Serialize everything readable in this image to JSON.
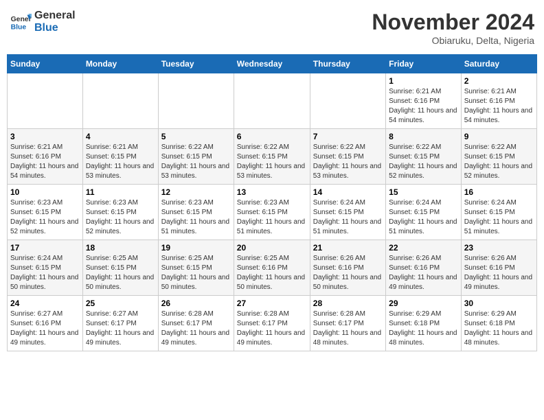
{
  "logo": {
    "line1": "General",
    "line2": "Blue"
  },
  "title": "November 2024",
  "location": "Obiaruku, Delta, Nigeria",
  "weekdays": [
    "Sunday",
    "Monday",
    "Tuesday",
    "Wednesday",
    "Thursday",
    "Friday",
    "Saturday"
  ],
  "weeks": [
    [
      {
        "day": "",
        "info": ""
      },
      {
        "day": "",
        "info": ""
      },
      {
        "day": "",
        "info": ""
      },
      {
        "day": "",
        "info": ""
      },
      {
        "day": "",
        "info": ""
      },
      {
        "day": "1",
        "info": "Sunrise: 6:21 AM\nSunset: 6:16 PM\nDaylight: 11 hours and 54 minutes."
      },
      {
        "day": "2",
        "info": "Sunrise: 6:21 AM\nSunset: 6:16 PM\nDaylight: 11 hours and 54 minutes."
      }
    ],
    [
      {
        "day": "3",
        "info": "Sunrise: 6:21 AM\nSunset: 6:16 PM\nDaylight: 11 hours and 54 minutes."
      },
      {
        "day": "4",
        "info": "Sunrise: 6:21 AM\nSunset: 6:15 PM\nDaylight: 11 hours and 53 minutes."
      },
      {
        "day": "5",
        "info": "Sunrise: 6:22 AM\nSunset: 6:15 PM\nDaylight: 11 hours and 53 minutes."
      },
      {
        "day": "6",
        "info": "Sunrise: 6:22 AM\nSunset: 6:15 PM\nDaylight: 11 hours and 53 minutes."
      },
      {
        "day": "7",
        "info": "Sunrise: 6:22 AM\nSunset: 6:15 PM\nDaylight: 11 hours and 53 minutes."
      },
      {
        "day": "8",
        "info": "Sunrise: 6:22 AM\nSunset: 6:15 PM\nDaylight: 11 hours and 52 minutes."
      },
      {
        "day": "9",
        "info": "Sunrise: 6:22 AM\nSunset: 6:15 PM\nDaylight: 11 hours and 52 minutes."
      }
    ],
    [
      {
        "day": "10",
        "info": "Sunrise: 6:23 AM\nSunset: 6:15 PM\nDaylight: 11 hours and 52 minutes."
      },
      {
        "day": "11",
        "info": "Sunrise: 6:23 AM\nSunset: 6:15 PM\nDaylight: 11 hours and 52 minutes."
      },
      {
        "day": "12",
        "info": "Sunrise: 6:23 AM\nSunset: 6:15 PM\nDaylight: 11 hours and 51 minutes."
      },
      {
        "day": "13",
        "info": "Sunrise: 6:23 AM\nSunset: 6:15 PM\nDaylight: 11 hours and 51 minutes."
      },
      {
        "day": "14",
        "info": "Sunrise: 6:24 AM\nSunset: 6:15 PM\nDaylight: 11 hours and 51 minutes."
      },
      {
        "day": "15",
        "info": "Sunrise: 6:24 AM\nSunset: 6:15 PM\nDaylight: 11 hours and 51 minutes."
      },
      {
        "day": "16",
        "info": "Sunrise: 6:24 AM\nSunset: 6:15 PM\nDaylight: 11 hours and 51 minutes."
      }
    ],
    [
      {
        "day": "17",
        "info": "Sunrise: 6:24 AM\nSunset: 6:15 PM\nDaylight: 11 hours and 50 minutes."
      },
      {
        "day": "18",
        "info": "Sunrise: 6:25 AM\nSunset: 6:15 PM\nDaylight: 11 hours and 50 minutes."
      },
      {
        "day": "19",
        "info": "Sunrise: 6:25 AM\nSunset: 6:15 PM\nDaylight: 11 hours and 50 minutes."
      },
      {
        "day": "20",
        "info": "Sunrise: 6:25 AM\nSunset: 6:16 PM\nDaylight: 11 hours and 50 minutes."
      },
      {
        "day": "21",
        "info": "Sunrise: 6:26 AM\nSunset: 6:16 PM\nDaylight: 11 hours and 50 minutes."
      },
      {
        "day": "22",
        "info": "Sunrise: 6:26 AM\nSunset: 6:16 PM\nDaylight: 11 hours and 49 minutes."
      },
      {
        "day": "23",
        "info": "Sunrise: 6:26 AM\nSunset: 6:16 PM\nDaylight: 11 hours and 49 minutes."
      }
    ],
    [
      {
        "day": "24",
        "info": "Sunrise: 6:27 AM\nSunset: 6:16 PM\nDaylight: 11 hours and 49 minutes."
      },
      {
        "day": "25",
        "info": "Sunrise: 6:27 AM\nSunset: 6:17 PM\nDaylight: 11 hours and 49 minutes."
      },
      {
        "day": "26",
        "info": "Sunrise: 6:28 AM\nSunset: 6:17 PM\nDaylight: 11 hours and 49 minutes."
      },
      {
        "day": "27",
        "info": "Sunrise: 6:28 AM\nSunset: 6:17 PM\nDaylight: 11 hours and 49 minutes."
      },
      {
        "day": "28",
        "info": "Sunrise: 6:28 AM\nSunset: 6:17 PM\nDaylight: 11 hours and 48 minutes."
      },
      {
        "day": "29",
        "info": "Sunrise: 6:29 AM\nSunset: 6:18 PM\nDaylight: 11 hours and 48 minutes."
      },
      {
        "day": "30",
        "info": "Sunrise: 6:29 AM\nSunset: 6:18 PM\nDaylight: 11 hours and 48 minutes."
      }
    ]
  ]
}
